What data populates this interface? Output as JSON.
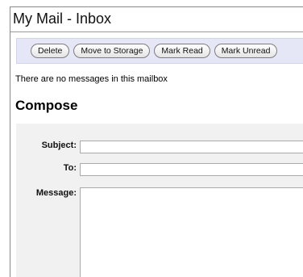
{
  "window": {
    "title": "My Mail - Inbox"
  },
  "toolbar": {
    "buttons": [
      {
        "label": "Delete"
      },
      {
        "label": "Move to Storage"
      },
      {
        "label": "Mark Read"
      },
      {
        "label": "Mark Unread"
      }
    ]
  },
  "mailbox": {
    "status_text": "There are no messages in this mailbox"
  },
  "compose": {
    "heading": "Compose",
    "subject": {
      "label": "Subject:",
      "value": ""
    },
    "to": {
      "label": "To:",
      "value": ""
    },
    "message": {
      "label": "Message:",
      "value": ""
    }
  }
}
